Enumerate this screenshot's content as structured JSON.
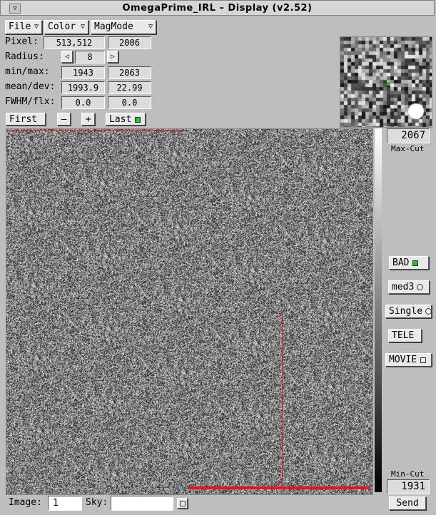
{
  "window": {
    "title": "OmegaPrime_IRL – Display (v2.52)",
    "menu_glyph": "▽"
  },
  "menus": {
    "file": "File",
    "color": "Color",
    "magmode": "MagMode",
    "arrow": "▽"
  },
  "info": {
    "pixel_label": "Pixel:",
    "pixel_xy": "513,512",
    "pixel_value": "2006",
    "radius_label": "Radius:",
    "radius_dec": "◁",
    "radius_value": "8",
    "radius_inc": "▷",
    "minmax_label": "min/max:",
    "min": "1943",
    "max": "2063",
    "meandev_label": "mean/dev:",
    "mean": "1993.9",
    "dev": "22.99",
    "fwhm_label": "FWHM/flx:",
    "fwhm": "0.0",
    "flx": "0.0"
  },
  "nav": {
    "first": "First",
    "minus": "–",
    "plus": "+",
    "last": "Last"
  },
  "cuts": {
    "max_value": "2067",
    "max_label": "Max-Cut",
    "min_value": "1931",
    "min_label": "Min-Cut"
  },
  "side_buttons": {
    "bad": "BAD",
    "med3": "med3",
    "single": "Single",
    "tele": "TELE",
    "movie": "MOVIE"
  },
  "bottom": {
    "image_label": "Image:",
    "image_value": "1",
    "sky_label": "Sky:",
    "sky_value": "",
    "send": "Send"
  },
  "colors": {
    "marker": "#e8141a",
    "indicator": "#1fc41f"
  }
}
